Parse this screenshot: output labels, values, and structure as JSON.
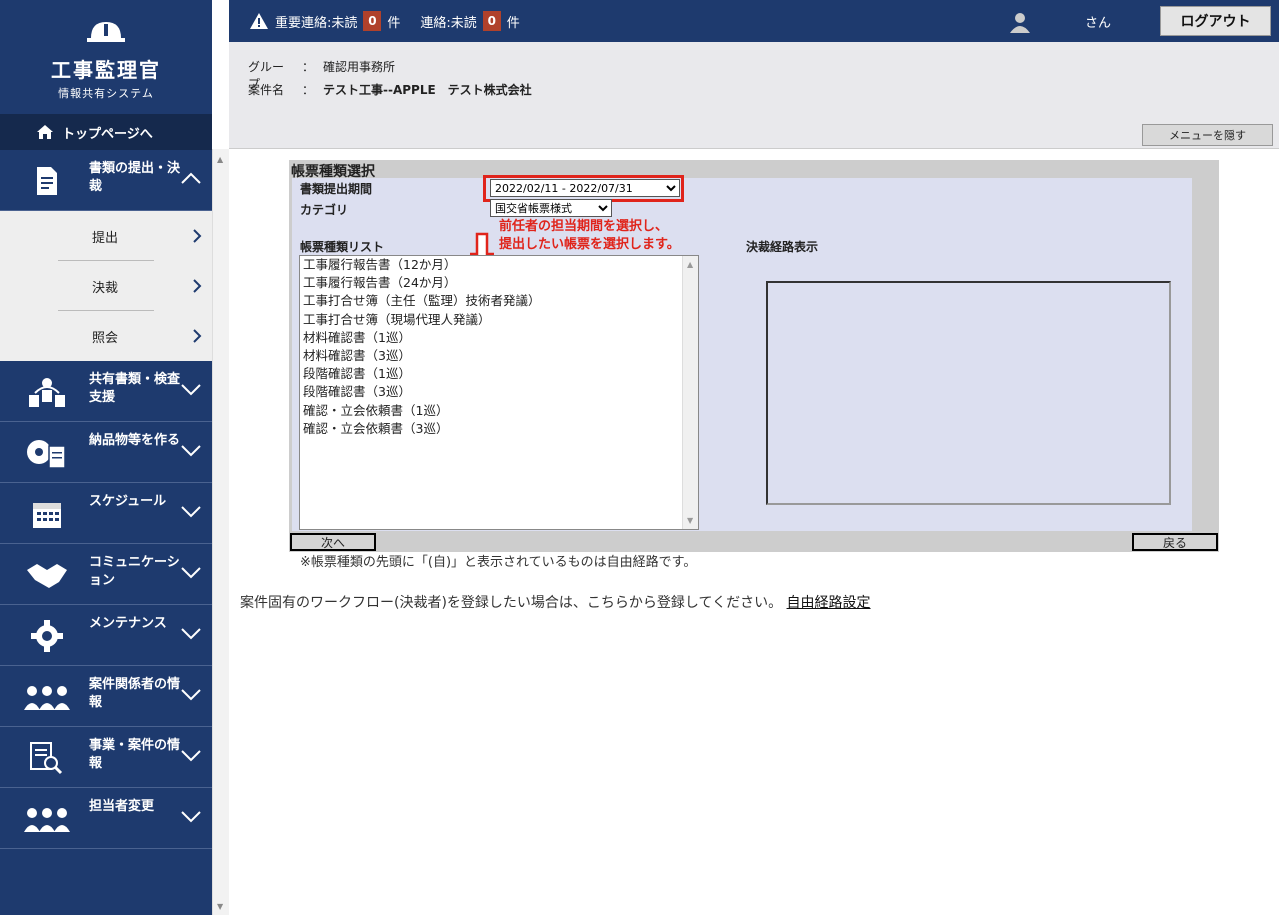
{
  "app": {
    "title": "工事監理官",
    "subtitle": "情報共有システム"
  },
  "sidebar": {
    "top_link": "トップページへ",
    "groups": [
      {
        "label": "書類の提出・決裁",
        "icon": "document-icon",
        "open": true
      },
      {
        "label": "共有書類・検査支援",
        "icon": "shared-docs-icon"
      },
      {
        "label": "納品物等を作る",
        "icon": "disc-document-icon"
      },
      {
        "label": "スケジュール",
        "icon": "calendar-icon"
      },
      {
        "label": "コミュニケーション",
        "icon": "handshake-icon"
      },
      {
        "label": "メンテナンス",
        "icon": "gear-icon"
      },
      {
        "label": "案件関係者の情報",
        "icon": "people-icon"
      },
      {
        "label": "事業・案件の情報",
        "icon": "document-search-icon"
      },
      {
        "label": "担当者変更",
        "icon": "people-icon"
      }
    ],
    "sub_items": [
      "提出",
      "決裁",
      "照会"
    ]
  },
  "topbar": {
    "important_label": "重要連絡:未読",
    "important_count": "0",
    "count_unit": "件",
    "contact_label": "連絡:未読",
    "contact_count": "0",
    "user_suffix": "さん",
    "logout": "ログアウト"
  },
  "info": {
    "group_key": "グループ",
    "group_value": "確認用事務所",
    "project_key": "案件名",
    "project_value": "テスト工事--APPLE　テスト株式会社",
    "colon": "：",
    "hide_menu": "メニューを隠す"
  },
  "form": {
    "title": "帳票種類選択",
    "period_label": "書類提出期間",
    "period_value": "2022/02/11 ‐ 2022/07/31",
    "category_label": "カテゴリ",
    "category_value": "国交省帳票様式",
    "annotation_line1": "前任者の担当期間を選択し、",
    "annotation_line2": "提出したい帳票を選択します。",
    "list_label": "帳票種類リスト",
    "route_label": "決裁経路表示",
    "list_items": [
      "工事履行報告書（12か月）",
      "工事履行報告書（24か月）",
      "工事打合せ簿（主任（監理）技術者発議）",
      "工事打合せ簿（現場代理人発議）",
      "材料確認書（1巡）",
      "材料確認書（3巡）",
      "段階確認書（1巡）",
      "段階確認書（3巡）",
      "確認・立会依頼書（1巡）",
      "確認・立会依頼書（3巡）"
    ],
    "next_button": "次へ",
    "back_button": "戻る",
    "note": "※帳票種類の先頭に「(自)」と表示されているものは自由経路です。",
    "workflow_text": "案件固有のワークフロー(決裁者)を登録したい場合は、こちらから登録してください。",
    "workflow_link": "自由経路設定"
  },
  "colors": {
    "navy": "#1e3a6e",
    "badge": "#b0412b",
    "highlight": "#e0241b",
    "panel": "#dcdff0"
  }
}
